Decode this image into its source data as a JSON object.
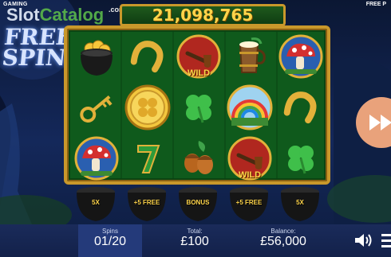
{
  "header": {
    "brand_label": "GAMING",
    "watermark_slot": "Slot",
    "watermark_catalog": "Catalog",
    "watermark_com": ".com",
    "right_label": "FREE P"
  },
  "title": {
    "line1": "FREE",
    "line2": "SPINS"
  },
  "win_counter": "21,098,765",
  "reels": {
    "wild_label": "WILD",
    "symbols": [
      [
        "pot-of-gold",
        "key",
        "mushroom"
      ],
      [
        "horseshoe",
        "gold-coin-clover",
        "seven"
      ],
      [
        "pipe-wild",
        "four-leaf-clover",
        "acorns"
      ],
      [
        "tankard",
        "rainbow",
        "pipe-wild"
      ],
      [
        "mushroom",
        "horseshoe",
        "four-leaf-clover"
      ]
    ]
  },
  "pots": [
    "5X",
    "+5 FREE",
    "BONUS",
    "+5 FREE",
    "5X"
  ],
  "bottom": {
    "spins_label": "Spins",
    "spins_value": "01/20",
    "total_label": "Total:",
    "total_value": "£100",
    "balance_label": "Balance:",
    "balance_value": "£56,000"
  },
  "colors": {
    "gold": "#c9982b",
    "reel_green": "#0f5a1c",
    "counter_text": "#ffd54a",
    "fast_forward_button": "#e9a27b"
  }
}
